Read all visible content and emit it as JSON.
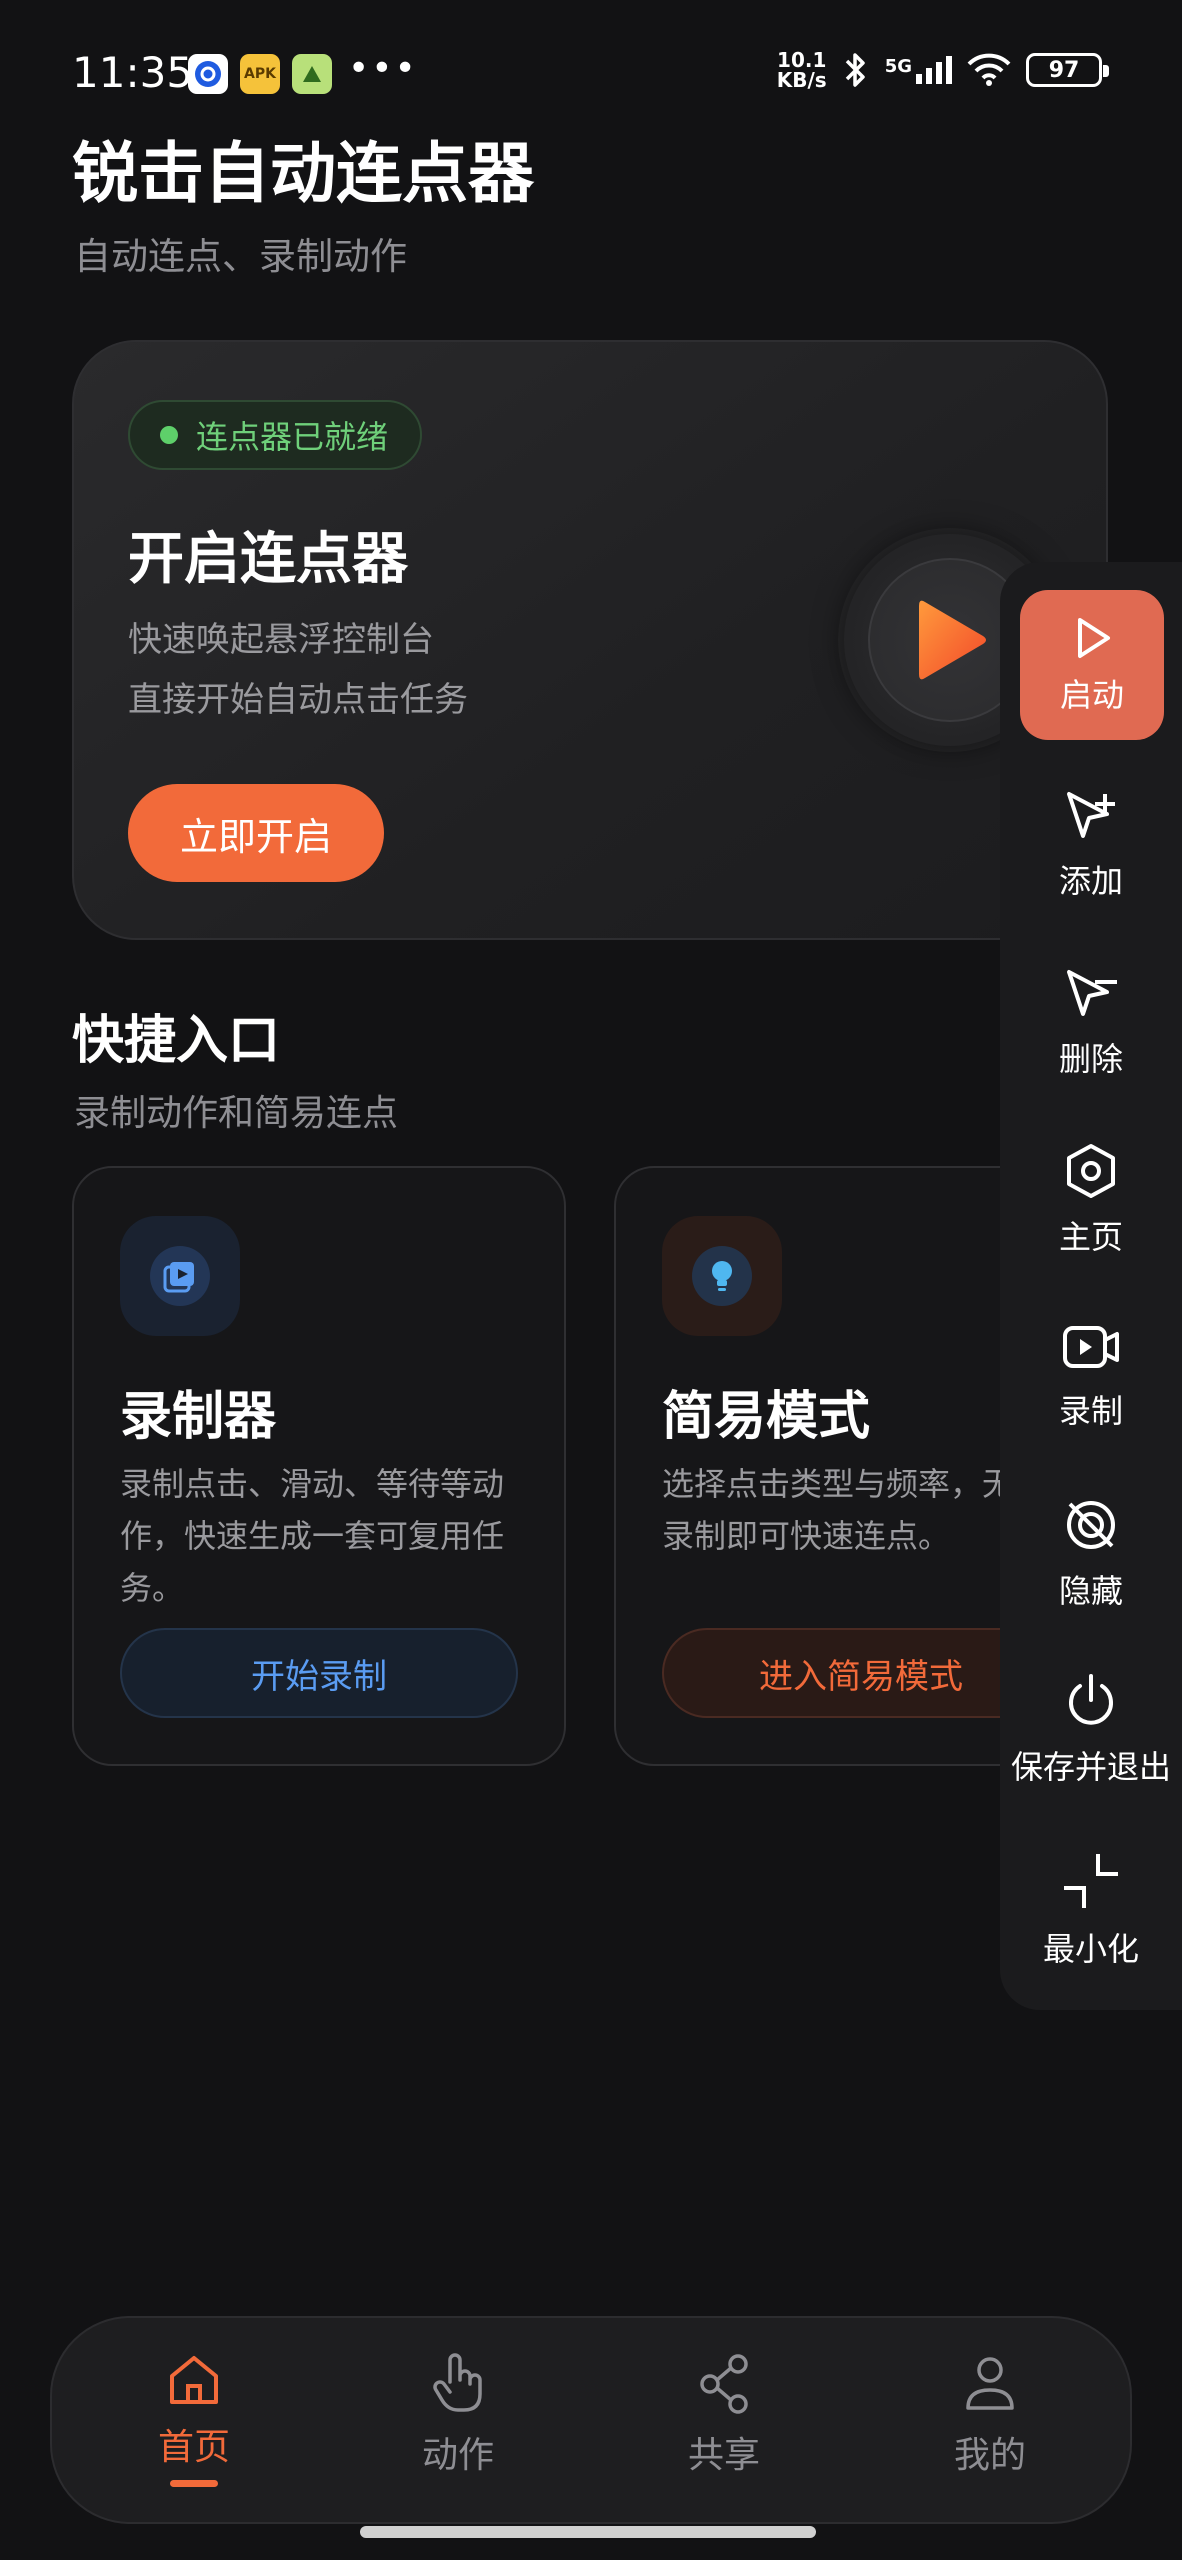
{
  "status_bar": {
    "time": "11:35",
    "apk_badge": "APK",
    "overflow": "•••",
    "net_speed_top": "10.1",
    "net_speed_bottom": "KB/s",
    "network": "5G",
    "battery": "97"
  },
  "header": {
    "title": "锐击自动连点器",
    "subtitle": "自动连点、录制动作"
  },
  "hero": {
    "status": "连点器已就绪",
    "status_color": "#5ed06a",
    "title": "开启连点器",
    "desc_line1": "快速唤起悬浮控制台",
    "desc_line2": "直接开始自动点击任务",
    "button": "立即开启",
    "accent": "#f26a3a"
  },
  "quick": {
    "title": "快捷入口",
    "subtitle": "录制动作和简易连点",
    "recorder": {
      "icon": "video-library-icon",
      "title": "录制器",
      "desc": "录制点击、滑动、等待等动作，快速生成一套可复用任务。",
      "button": "开始录制"
    },
    "easy": {
      "icon": "lightbulb-icon",
      "title": "简易模式",
      "desc": "选择点击类型与频率，无需录制即可快速连点。",
      "button": "进入简易模式"
    }
  },
  "side_panel": {
    "items": [
      {
        "label": "启动",
        "icon": "play-icon"
      },
      {
        "label": "添加",
        "icon": "cursor-add-icon"
      },
      {
        "label": "删除",
        "icon": "cursor-remove-icon"
      },
      {
        "label": "主页",
        "icon": "hexagon-settings-icon"
      },
      {
        "label": "录制",
        "icon": "video-record-icon"
      },
      {
        "label": "隐藏",
        "icon": "eye-off-icon"
      },
      {
        "label": "保存并退出",
        "icon": "power-icon"
      },
      {
        "label": "最小化",
        "icon": "minimize-icon"
      }
    ]
  },
  "bottom_nav": {
    "items": [
      {
        "label": "首页",
        "icon": "home-icon",
        "active": true
      },
      {
        "label": "动作",
        "icon": "hand-pointer-icon",
        "active": false
      },
      {
        "label": "共享",
        "icon": "share-icon",
        "active": false
      },
      {
        "label": "我的",
        "icon": "user-icon",
        "active": false
      }
    ]
  }
}
